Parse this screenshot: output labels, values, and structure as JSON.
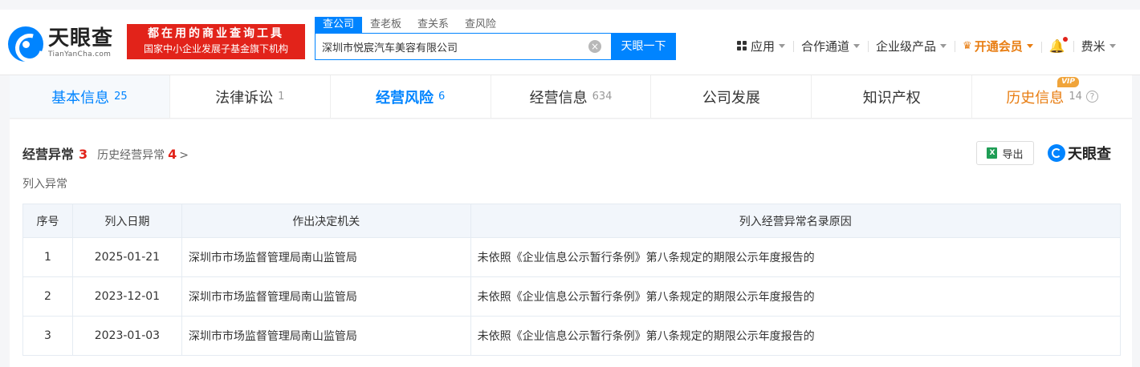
{
  "header": {
    "logo_text": "天眼查",
    "logo_sub": "TianYanCha.com",
    "slogan_line1": "都在用的商业查询工具",
    "slogan_line2": "国家中小企业发展子基金旗下机构",
    "search_tabs": [
      "查公司",
      "查老板",
      "查关系",
      "查风险"
    ],
    "search_value": "深圳市悦宸汽车美容有限公司",
    "search_button": "天眼一下",
    "clear_symbol": "×",
    "nav": {
      "apps": "应用",
      "cooperation": "合作通道",
      "enterprise": "企业级产品",
      "vip": "开通会员",
      "user": "费米"
    }
  },
  "tabs": [
    {
      "label": "基本信息",
      "count": "25"
    },
    {
      "label": "法律诉讼",
      "count": "1"
    },
    {
      "label": "经营风险",
      "count": "6"
    },
    {
      "label": "经营信息",
      "count": "634"
    },
    {
      "label": "公司发展",
      "count": ""
    },
    {
      "label": "知识产权",
      "count": ""
    },
    {
      "label": "历史信息",
      "count": "14",
      "badge": "VIP"
    }
  ],
  "section": {
    "title": "经营异常",
    "count": "3",
    "history_label": "历史经营异常",
    "history_count": "4",
    "chevron": ">",
    "sub_title": "列入异常",
    "export_label": "导出",
    "excel_glyph": "X",
    "brand_text": "天眼查"
  },
  "table": {
    "headers": [
      "序号",
      "列入日期",
      "作出决定机关",
      "列入经营异常名录原因"
    ],
    "rows": [
      {
        "no": "1",
        "date": "2025-01-21",
        "authority": "深圳市市场监督管理局南山监管局",
        "reason": "未依照《企业信息公示暂行条例》第八条规定的期限公示年度报告的"
      },
      {
        "no": "2",
        "date": "2023-12-01",
        "authority": "深圳市市场监督管理局南山监管局",
        "reason": "未依照《企业信息公示暂行条例》第八条规定的期限公示年度报告的"
      },
      {
        "no": "3",
        "date": "2023-01-03",
        "authority": "深圳市市场监督管理局南山监管局",
        "reason": "未依照《企业信息公示暂行条例》第八条规定的期限公示年度报告的"
      }
    ]
  },
  "colors": {
    "brand_blue": "#0084ff",
    "alert_red": "#e2231a",
    "vip_orange": "#e87d12"
  }
}
